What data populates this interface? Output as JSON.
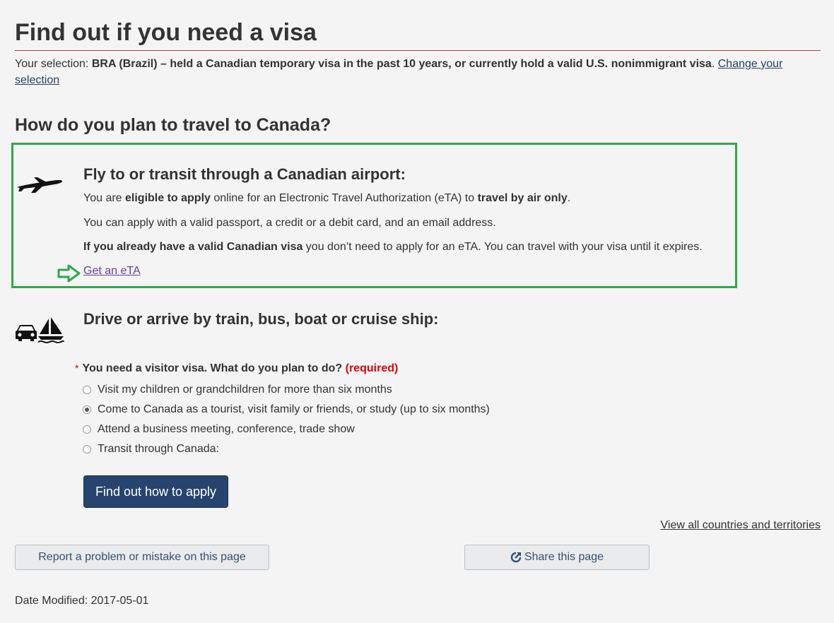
{
  "header": {
    "title": "Find out if you need a visa"
  },
  "selection": {
    "prefix": "Your selection:",
    "value": "BRA (Brazil) – held a Canadian temporary visa in the past 10 years, or currently hold a valid U.S. nonimmigrant visa",
    "suffix": ".",
    "change_link": "Change your selection"
  },
  "travel": {
    "heading": "How do you plan to travel to Canada?"
  },
  "air": {
    "heading": "Fly to or transit through a Canadian airport:",
    "p1_a": "You are ",
    "p1_b": "eligible to apply",
    "p1_c": " online for an Electronic Travel Authorization (eTA) to ",
    "p1_d": "travel by air only",
    "p1_e": ".",
    "p2": "You can apply with a valid passport, a credit or a debit card, and an email address.",
    "p3_a": "If you already have a valid Canadian visa",
    "p3_b": " you don’t need to apply for an eTA. You can travel with your visa until it expires.",
    "link": "Get an eTA",
    "icons": {
      "plane": "airplane-icon",
      "arrow": "arrow-right-icon"
    },
    "highlight_color": "#2ea84a"
  },
  "land": {
    "heading": "Drive or arrive by train, bus, boat or cruise ship:",
    "icons": {
      "car": "car-icon",
      "boat": "sailboat-icon"
    },
    "question": "You need a visitor visa. What do you plan to do?",
    "required_label": "(required)",
    "required_marker": "*",
    "options": [
      {
        "label": "Visit my children or grandchildren for more than six months",
        "selected": false
      },
      {
        "label": "Come to Canada as a tourist, visit family or friends, or study (up to six months)",
        "selected": true
      },
      {
        "label": "Attend a business meeting, conference, trade show",
        "selected": false
      },
      {
        "label": "Transit through Canada:",
        "selected": false
      }
    ],
    "button": "Find out how to apply"
  },
  "footer": {
    "view_all": "View all countries and territories",
    "report": "Report a problem or mistake on this page",
    "share": "Share this page",
    "share_icon": "share-icon",
    "date_modified": "Date Modified: 2017-05-01"
  },
  "colors": {
    "background": "#f4f4f4",
    "primary_button": "#26446e",
    "title_rule": "#af3c43",
    "required": "#d3080c",
    "visited_link": "#6b3f9a"
  }
}
